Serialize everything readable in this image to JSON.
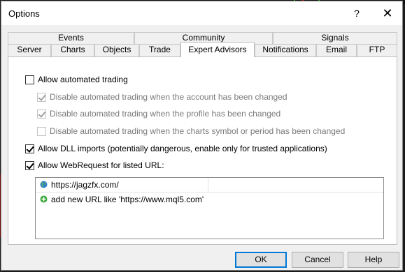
{
  "window": {
    "title": "Options",
    "help_glyph": "?",
    "close_glyph": "✕"
  },
  "tabs": {
    "row1": [
      {
        "label": "Events"
      },
      {
        "label": "Community"
      },
      {
        "label": "Signals"
      }
    ],
    "row2": [
      {
        "label": "Server"
      },
      {
        "label": "Charts"
      },
      {
        "label": "Objects"
      },
      {
        "label": "Trade"
      },
      {
        "label": "Expert Advisors",
        "active": true
      },
      {
        "label": "Notifications"
      },
      {
        "label": "Email"
      },
      {
        "label": "FTP"
      }
    ]
  },
  "settings": {
    "allow_automated_trading": {
      "label": "Allow automated trading",
      "checked": false
    },
    "disable_on_account_change": {
      "label": "Disable automated trading when the account has been changed",
      "checked": true,
      "enabled": false
    },
    "disable_on_profile_change": {
      "label": "Disable automated trading when the profile has been changed",
      "checked": true,
      "enabled": false
    },
    "disable_on_symbol_change": {
      "label": "Disable automated trading when the charts symbol or period has been changed",
      "checked": false,
      "enabled": false
    },
    "allow_dll_imports": {
      "label": "Allow DLL imports (potentially dangerous, enable only for trusted applications)",
      "checked": true
    },
    "allow_webrequest": {
      "label": "Allow WebRequest for listed URL:",
      "checked": true
    }
  },
  "url_list": {
    "items": [
      {
        "url": "https://jagzfx.com/",
        "icon": "globe-icon"
      }
    ],
    "add_new": {
      "label": "add new URL like 'https://www.mql5.com'",
      "icon": "add-plus-icon"
    }
  },
  "buttons": {
    "ok": "OK",
    "cancel": "Cancel",
    "help": "Help"
  },
  "colors": {
    "accent": "#0078d7",
    "add_icon_green": "#3aa63a",
    "globe_blue": "#2f7fc9"
  }
}
